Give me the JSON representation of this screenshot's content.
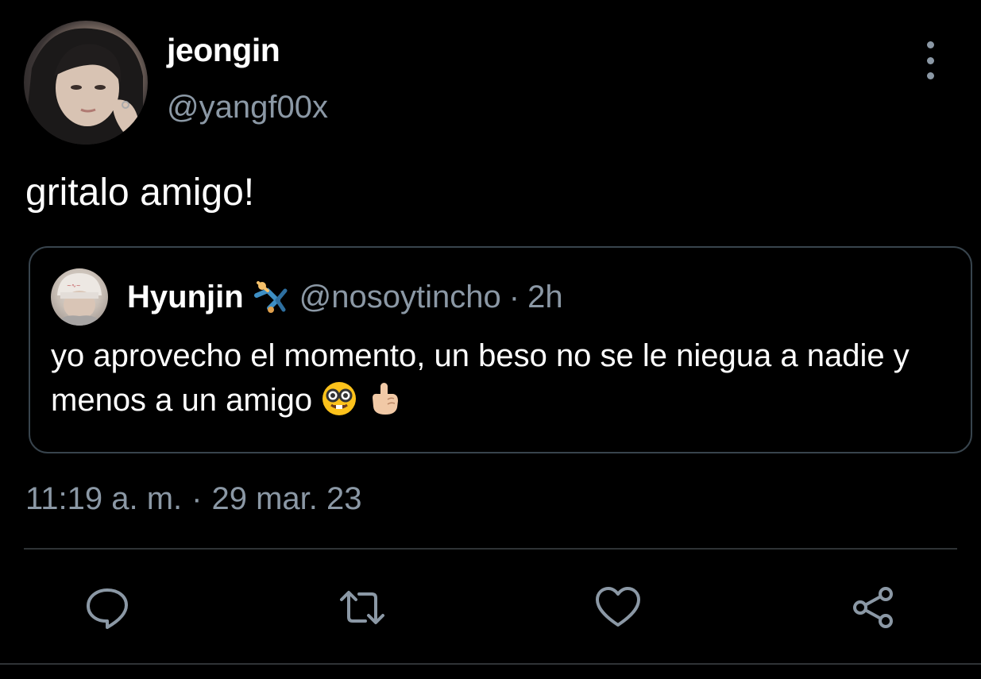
{
  "tweet": {
    "display_name": "jeongin",
    "handle": "@yangf00x",
    "text": "gritalo amigo!",
    "timestamp_time": "11:19 a. m.",
    "separator": "·",
    "timestamp_date": "29 mar. 23"
  },
  "quoted_tweet": {
    "display_name": "Hyunjin",
    "name_emoji": "cartwheel-person-emoji",
    "handle": "@nosoytincho",
    "separator": "·",
    "time": "2h",
    "text": "yo aprovecho el momento, un beso no se le niegua a nadie y menos a un amigo",
    "trailing_emojis": [
      "nerd-face-emoji",
      "index-pointing-up-emoji"
    ]
  },
  "actions": [
    {
      "name": "reply",
      "icon": "reply-icon"
    },
    {
      "name": "retweet",
      "icon": "retweet-icon"
    },
    {
      "name": "like",
      "icon": "heart-icon"
    },
    {
      "name": "share",
      "icon": "share-icon"
    }
  ],
  "colors": {
    "background": "#000000",
    "primary_text": "#ffffff",
    "secondary_text": "#8b98a5",
    "border": "#38444d",
    "icon": "#8b98a5"
  }
}
